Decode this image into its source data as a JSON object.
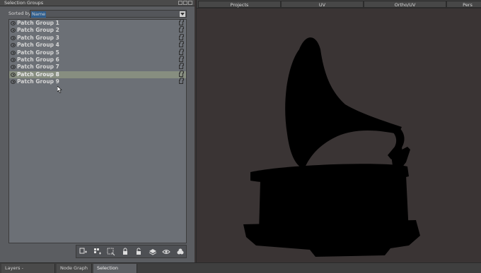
{
  "left_panel": {
    "title": "Selection Groups",
    "sort_label": "Sorted by",
    "sort_value": "Name",
    "groups": [
      {
        "name": "Patch Group 1",
        "selected": false
      },
      {
        "name": "Patch Group 2",
        "selected": false
      },
      {
        "name": "Patch Group 3",
        "selected": false
      },
      {
        "name": "Patch Group 4",
        "selected": false
      },
      {
        "name": "Patch Group 5",
        "selected": false
      },
      {
        "name": "Patch Group 6",
        "selected": false
      },
      {
        "name": "Patch Group 7",
        "selected": false
      },
      {
        "name": "Patch Group 8",
        "selected": true
      },
      {
        "name": "Patch Group 9",
        "selected": false
      }
    ],
    "toolbar_icons": [
      "add-group-icon",
      "add-from-selection-icon",
      "select-icon",
      "lock-icon",
      "unlock-icon",
      "layers-icon",
      "eye-icon",
      "cluster-icon"
    ]
  },
  "bottom_tabs": {
    "layers": "Layers - _materialID",
    "node_graph": "Node Graph",
    "selection_groups": "Selection Groups"
  },
  "viewport": {
    "tabs": [
      "Projects",
      "UV",
      "Ortho/UV",
      "Pers"
    ]
  },
  "colors": {
    "panel_bg": "#5b5d61",
    "list_bg": "#6c7076",
    "selected_row": "#878e80",
    "viewport_bg": "#3a3434",
    "model": "#000000"
  }
}
